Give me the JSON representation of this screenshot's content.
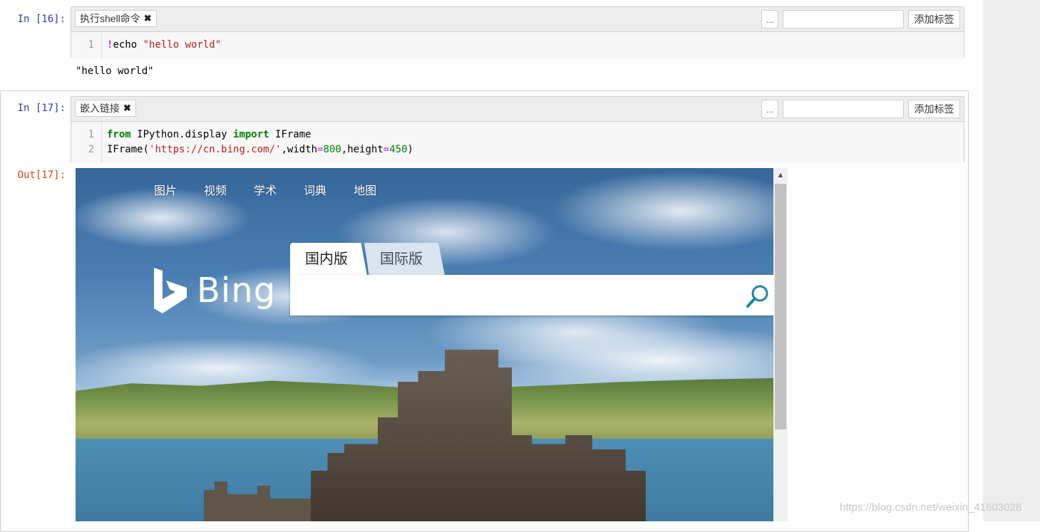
{
  "cells": [
    {
      "prompt": "In  [16]:",
      "tag": "执行shell命令",
      "tag_remove_icon": "✖",
      "tag_menu_label": "...",
      "add_tag_label": "添加标签",
      "line_numbers": [
        "1"
      ],
      "code": {
        "bang": "!",
        "cmd": "echo ",
        "str": "\"hello world\""
      },
      "output": "\"hello world\""
    },
    {
      "prompt": "In  [17]:",
      "out_prompt": "Out[17]:",
      "tag": "嵌入链接",
      "tag_remove_icon": "✖",
      "tag_menu_label": "...",
      "add_tag_label": "添加标签",
      "line_numbers": [
        "1",
        "2"
      ],
      "code_line1": {
        "kw1": "from",
        "mod": " IPython.display ",
        "kw2": "import",
        "name": " IFrame"
      },
      "code_line2": {
        "fn": "IFrame(",
        "url": "'https://cn.bing.com/'",
        "c1": ",width",
        "eq1": "=",
        "n1": "800",
        "c2": ",height",
        "eq2": "=",
        "n2": "450",
        "close": ")"
      }
    }
  ],
  "bing": {
    "nav": [
      "图片",
      "视频",
      "学术",
      "词典",
      "地图"
    ],
    "logo_text": "Bing",
    "tab_active": "国内版",
    "tab_inactive": "国际版",
    "accent": "#1a87a8",
    "scroll_up_icon": "▲"
  },
  "watermark": "https://blog.csdn.net/weixin_41603028"
}
